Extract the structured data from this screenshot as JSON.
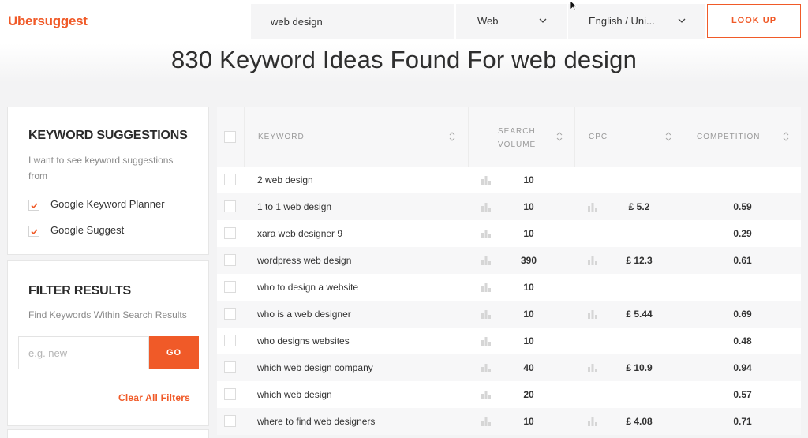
{
  "header": {
    "logo": "Ubersuggest",
    "search_value": "web design",
    "source_select": "Web",
    "language_select": "English / Uni...",
    "lookup_label": "LOOK UP"
  },
  "title": "830 Keyword Ideas Found For web design",
  "sidebar": {
    "suggestions": {
      "heading": "KEYWORD SUGGESTIONS",
      "description": "I want to see keyword suggestions from",
      "options": [
        {
          "label": "Google Keyword Planner",
          "checked": true
        },
        {
          "label": "Google Suggest",
          "checked": true
        }
      ]
    },
    "filter": {
      "heading": "FILTER RESULTS",
      "description": "Find Keywords Within Search Results",
      "placeholder": "e.g. new",
      "go_label": "GO",
      "clear_label": "Clear All Filters"
    }
  },
  "table": {
    "columns": {
      "keyword": "KEYWORD",
      "search_volume": "SEARCH VOLUME",
      "cpc": "CPC",
      "competition": "COMPETITION"
    },
    "rows": [
      {
        "keyword": "2 web design",
        "volume": "10",
        "cpc": "",
        "competition": ""
      },
      {
        "keyword": "1 to 1 web design",
        "volume": "10",
        "cpc": "£ 5.2",
        "competition": "0.59"
      },
      {
        "keyword": "xara web designer 9",
        "volume": "10",
        "cpc": "",
        "competition": "0.29"
      },
      {
        "keyword": "wordpress web design",
        "volume": "390",
        "cpc": "£ 12.3",
        "competition": "0.61"
      },
      {
        "keyword": "who to design a website",
        "volume": "10",
        "cpc": "",
        "competition": ""
      },
      {
        "keyword": "who is a web designer",
        "volume": "10",
        "cpc": "£ 5.44",
        "competition": "0.69"
      },
      {
        "keyword": "who designs websites",
        "volume": "10",
        "cpc": "",
        "competition": "0.48"
      },
      {
        "keyword": "which web design company",
        "volume": "40",
        "cpc": "£ 10.9",
        "competition": "0.94"
      },
      {
        "keyword": "which web design",
        "volume": "20",
        "cpc": "",
        "competition": "0.57"
      },
      {
        "keyword": "where to find web designers",
        "volume": "10",
        "cpc": "£ 4.08",
        "competition": "0.71"
      }
    ]
  },
  "colors": {
    "accent": "#f05a28"
  }
}
